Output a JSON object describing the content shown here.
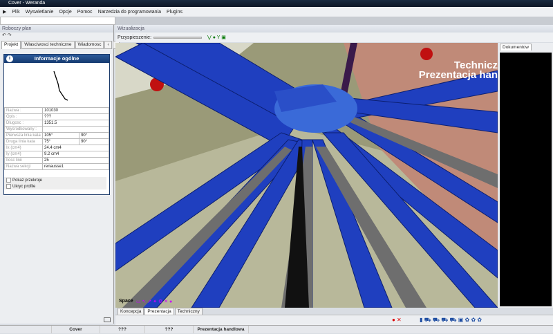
{
  "window": {
    "title": "Cover - Weranda"
  },
  "menu": [
    "Plik",
    "Wyswietlanie",
    "Opcje",
    "Pomoc",
    "Narzedzia do programowania",
    "Plugins"
  ],
  "left_panel": {
    "title": "Roboczy plan",
    "tabs": [
      "Projekt",
      "Wlasciwosci techniczne",
      "Wiadomosc"
    ],
    "info": {
      "title": "Informacje ogólne",
      "rows": [
        [
          "Nazwa :",
          "101030",
          ""
        ],
        [
          "Opis :",
          "???",
          ""
        ],
        [
          "Dlugosc :",
          "1351.5",
          ""
        ],
        [
          "Wysrodkowany :",
          "",
          ""
        ],
        [
          "Pierwsza linia kata",
          "105°",
          "90°"
        ],
        [
          "Druga linia kata",
          "75°",
          "90°"
        ],
        [
          "Ix (cm4)",
          "24.4 cm4",
          ""
        ],
        [
          "Iy (cm4)",
          "9.2 cm4",
          ""
        ],
        [
          "Ilosc linii",
          "25",
          ""
        ],
        [
          "Nazwa sekcji",
          "renausse1",
          ""
        ]
      ],
      "checks": [
        "Pokaz przekroje",
        "Ukryc profile"
      ]
    }
  },
  "viz": {
    "title": "Wizualizacja",
    "speed_label": "Przyspieszenie:",
    "overlay": [
      "Technicz",
      "Prezentacja han"
    ],
    "space_label": "Space",
    "tabs": [
      "Koncepcja",
      "Prezentacja",
      "Techniczny"
    ]
  },
  "docs": {
    "tab": "Dokumentow"
  },
  "status": [
    "Cover",
    "???",
    "???",
    "Prezentacja handlowa"
  ],
  "colors": {
    "beam_blue": "#1f3fbf",
    "beam_gray": "#6e6e6e",
    "title_dark": "#0d1626"
  }
}
